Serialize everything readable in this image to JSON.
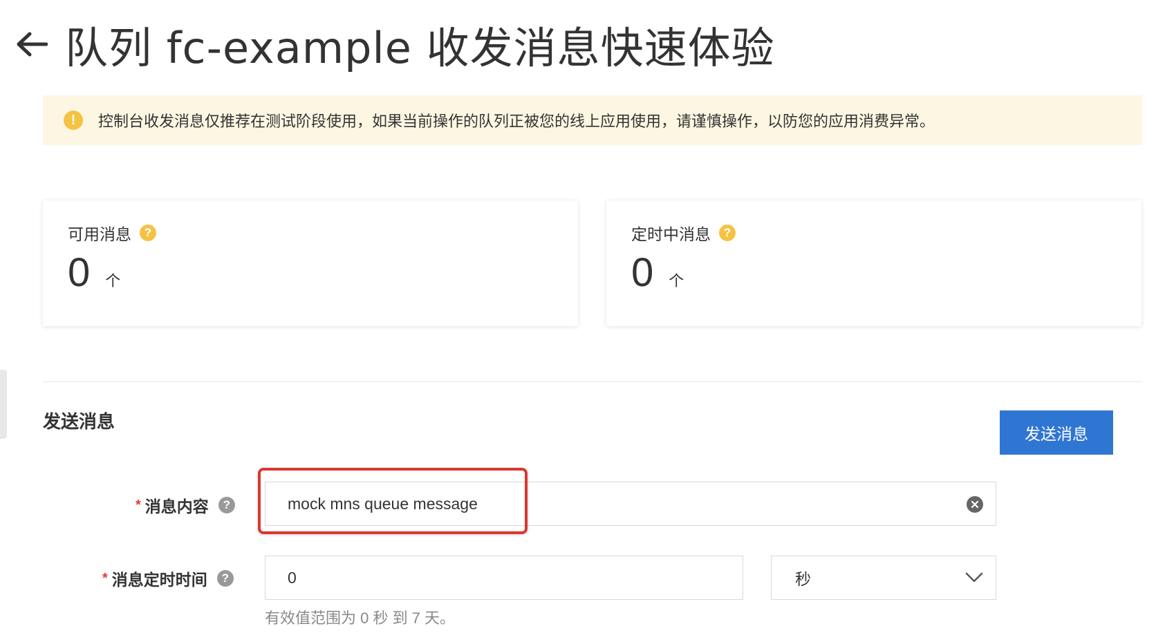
{
  "header": {
    "title": "队列 fc-example 收发消息快速体验"
  },
  "warning": {
    "text": "控制台收发消息仅推荐在测试阶段使用，如果当前操作的队列正被您的线上应用使用，请谨慎操作，以防您的应用消费异常。"
  },
  "stats": [
    {
      "label": "可用消息",
      "value": "0",
      "unit": "个"
    },
    {
      "label": "定时中消息",
      "value": "0",
      "unit": "个"
    }
  ],
  "send_section": {
    "title": "发送消息",
    "send_button_label": "发送消息",
    "fields": {
      "content": {
        "label": "消息内容",
        "value": "mock mns queue message"
      },
      "delay": {
        "label": "消息定时时间",
        "value": "0",
        "unit": "秒",
        "hint": "有效值范围为 0 秒 到 7 天。"
      }
    }
  },
  "colors": {
    "primary": "#2f76d2",
    "warning_bg": "#fdf6e2",
    "warning_icon": "#f5c242",
    "required": "#e23c39",
    "highlight": "#d9382e"
  },
  "icons": {
    "back": "arrow-left-icon",
    "warning": "exclamation-circle-icon",
    "help": "question-circle-icon",
    "clear": "close-circle-icon",
    "dropdown": "chevron-down-icon"
  }
}
